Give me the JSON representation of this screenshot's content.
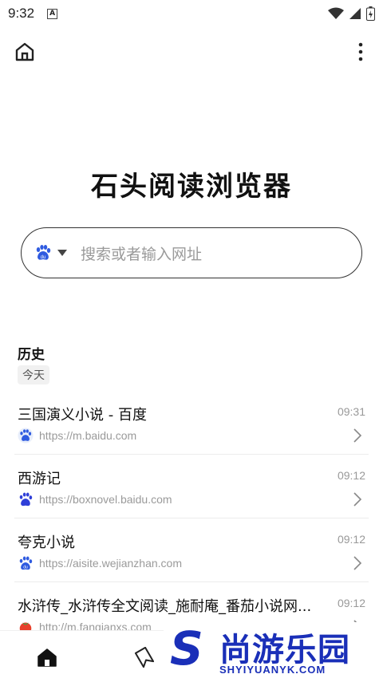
{
  "status_bar": {
    "time": "9:32",
    "notification_glyph": "A",
    "icons": [
      "wifi-icon",
      "signal-icon",
      "battery-charging-icon"
    ]
  },
  "top_bar": {
    "icons": [
      "home-icon",
      "more-vertical-icon"
    ]
  },
  "app_title": "石头阅读浏览器",
  "search": {
    "engine_icon": "baidu-paw-icon",
    "placeholder": "搜索或者输入网址"
  },
  "history": {
    "title": "历史",
    "group_label": "今天",
    "items": [
      {
        "title": "三国演义小说 - 百度",
        "time": "09:31",
        "url": "https://m.baidu.com",
        "favicon": "baidu-paw-icon"
      },
      {
        "title": "西游记",
        "time": "09:12",
        "url": "https://boxnovel.baidu.com",
        "favicon": "baidu-paw-icon"
      },
      {
        "title": "夸克小说",
        "time": "09:12",
        "url": "https://aisite.wejianzhan.com",
        "favicon": "baidu-paw-icon"
      },
      {
        "title": "水浒传_水浒传全文阅读_施耐庵_番茄小说网...",
        "time": "09:12",
        "url": "http://m.fanqianxs.com",
        "favicon": "tomato-icon"
      }
    ]
  },
  "bottom_nav": {
    "icons": [
      "home-filled-icon",
      "bookmark-icon"
    ]
  },
  "watermark": {
    "logo_letter": "S",
    "name": "尚游乐园",
    "sub": "SHYIYUANYK.COM"
  }
}
